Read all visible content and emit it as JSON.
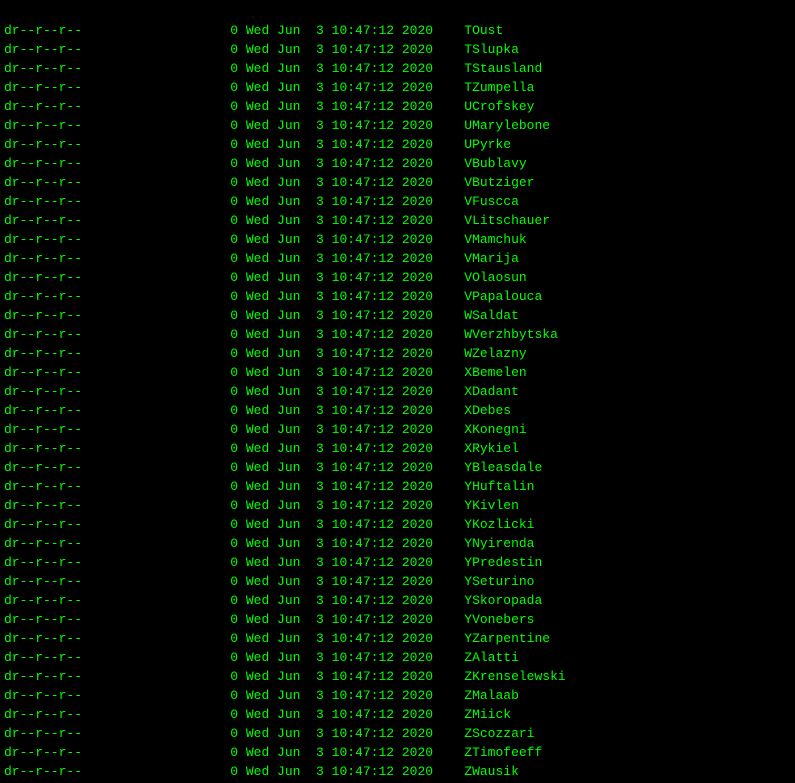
{
  "entries": [
    {
      "permissions": "dr--r--r--",
      "size": "0",
      "date": "Wed Jun  3 10:47:12 2020",
      "name": "TOust"
    },
    {
      "permissions": "dr--r--r--",
      "size": "0",
      "date": "Wed Jun  3 10:47:12 2020",
      "name": "TSlupka"
    },
    {
      "permissions": "dr--r--r--",
      "size": "0",
      "date": "Wed Jun  3 10:47:12 2020",
      "name": "TStausland"
    },
    {
      "permissions": "dr--r--r--",
      "size": "0",
      "date": "Wed Jun  3 10:47:12 2020",
      "name": "TZumpella"
    },
    {
      "permissions": "dr--r--r--",
      "size": "0",
      "date": "Wed Jun  3 10:47:12 2020",
      "name": "UCrofskey"
    },
    {
      "permissions": "dr--r--r--",
      "size": "0",
      "date": "Wed Jun  3 10:47:12 2020",
      "name": "UMarylebone"
    },
    {
      "permissions": "dr--r--r--",
      "size": "0",
      "date": "Wed Jun  3 10:47:12 2020",
      "name": "UPyrke"
    },
    {
      "permissions": "dr--r--r--",
      "size": "0",
      "date": "Wed Jun  3 10:47:12 2020",
      "name": "VBublavy"
    },
    {
      "permissions": "dr--r--r--",
      "size": "0",
      "date": "Wed Jun  3 10:47:12 2020",
      "name": "VButziger"
    },
    {
      "permissions": "dr--r--r--",
      "size": "0",
      "date": "Wed Jun  3 10:47:12 2020",
      "name": "VFuscca"
    },
    {
      "permissions": "dr--r--r--",
      "size": "0",
      "date": "Wed Jun  3 10:47:12 2020",
      "name": "VLitschauer"
    },
    {
      "permissions": "dr--r--r--",
      "size": "0",
      "date": "Wed Jun  3 10:47:12 2020",
      "name": "VMamchuk"
    },
    {
      "permissions": "dr--r--r--",
      "size": "0",
      "date": "Wed Jun  3 10:47:12 2020",
      "name": "VMarija"
    },
    {
      "permissions": "dr--r--r--",
      "size": "0",
      "date": "Wed Jun  3 10:47:12 2020",
      "name": "VOlaosun"
    },
    {
      "permissions": "dr--r--r--",
      "size": "0",
      "date": "Wed Jun  3 10:47:12 2020",
      "name": "VPapalouca"
    },
    {
      "permissions": "dr--r--r--",
      "size": "0",
      "date": "Wed Jun  3 10:47:12 2020",
      "name": "WSaldat"
    },
    {
      "permissions": "dr--r--r--",
      "size": "0",
      "date": "Wed Jun  3 10:47:12 2020",
      "name": "WVerzhbytska"
    },
    {
      "permissions": "dr--r--r--",
      "size": "0",
      "date": "Wed Jun  3 10:47:12 2020",
      "name": "WZelazny"
    },
    {
      "permissions": "dr--r--r--",
      "size": "0",
      "date": "Wed Jun  3 10:47:12 2020",
      "name": "XBemelen"
    },
    {
      "permissions": "dr--r--r--",
      "size": "0",
      "date": "Wed Jun  3 10:47:12 2020",
      "name": "XDadant"
    },
    {
      "permissions": "dr--r--r--",
      "size": "0",
      "date": "Wed Jun  3 10:47:12 2020",
      "name": "XDebes"
    },
    {
      "permissions": "dr--r--r--",
      "size": "0",
      "date": "Wed Jun  3 10:47:12 2020",
      "name": "XKonegni"
    },
    {
      "permissions": "dr--r--r--",
      "size": "0",
      "date": "Wed Jun  3 10:47:12 2020",
      "name": "XRykiel"
    },
    {
      "permissions": "dr--r--r--",
      "size": "0",
      "date": "Wed Jun  3 10:47:12 2020",
      "name": "YBleasdale"
    },
    {
      "permissions": "dr--r--r--",
      "size": "0",
      "date": "Wed Jun  3 10:47:12 2020",
      "name": "YHuftalin"
    },
    {
      "permissions": "dr--r--r--",
      "size": "0",
      "date": "Wed Jun  3 10:47:12 2020",
      "name": "YKivlen"
    },
    {
      "permissions": "dr--r--r--",
      "size": "0",
      "date": "Wed Jun  3 10:47:12 2020",
      "name": "YKozlicki"
    },
    {
      "permissions": "dr--r--r--",
      "size": "0",
      "date": "Wed Jun  3 10:47:12 2020",
      "name": "YNyirenda"
    },
    {
      "permissions": "dr--r--r--",
      "size": "0",
      "date": "Wed Jun  3 10:47:12 2020",
      "name": "YPredestin"
    },
    {
      "permissions": "dr--r--r--",
      "size": "0",
      "date": "Wed Jun  3 10:47:12 2020",
      "name": "YSeturino"
    },
    {
      "permissions": "dr--r--r--",
      "size": "0",
      "date": "Wed Jun  3 10:47:12 2020",
      "name": "YSkoropada"
    },
    {
      "permissions": "dr--r--r--",
      "size": "0",
      "date": "Wed Jun  3 10:47:12 2020",
      "name": "YVonebers"
    },
    {
      "permissions": "dr--r--r--",
      "size": "0",
      "date": "Wed Jun  3 10:47:12 2020",
      "name": "YZarpentine"
    },
    {
      "permissions": "dr--r--r--",
      "size": "0",
      "date": "Wed Jun  3 10:47:12 2020",
      "name": "ZAlatti"
    },
    {
      "permissions": "dr--r--r--",
      "size": "0",
      "date": "Wed Jun  3 10:47:12 2020",
      "name": "ZKrenselewski"
    },
    {
      "permissions": "dr--r--r--",
      "size": "0",
      "date": "Wed Jun  3 10:47:12 2020",
      "name": "ZMalaab"
    },
    {
      "permissions": "dr--r--r--",
      "size": "0",
      "date": "Wed Jun  3 10:47:12 2020",
      "name": "ZMiick"
    },
    {
      "permissions": "dr--r--r--",
      "size": "0",
      "date": "Wed Jun  3 10:47:12 2020",
      "name": "ZScozzari"
    },
    {
      "permissions": "dr--r--r--",
      "size": "0",
      "date": "Wed Jun  3 10:47:12 2020",
      "name": "ZTimofeeff"
    },
    {
      "permissions": "dr--r--r--",
      "size": "0",
      "date": "Wed Jun  3 10:47:12 2020",
      "name": "ZWausik"
    }
  ]
}
